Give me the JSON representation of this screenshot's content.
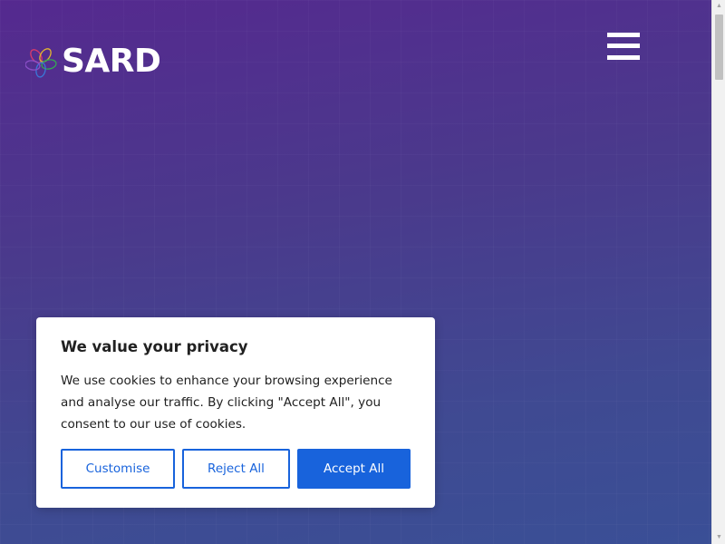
{
  "header": {
    "logo_text": "SARD",
    "logo_icon": "flower-logo-icon",
    "menu_icon": "hamburger-menu-icon"
  },
  "colors": {
    "hero_gradient_top": "#55298f",
    "hero_gradient_bottom": "#3a4f96",
    "accent_blue": "#1863dc",
    "logo_petals": [
      "#d93a6b",
      "#e2b530",
      "#35a853",
      "#3a76d6",
      "#8a4fc7"
    ]
  },
  "cookie_banner": {
    "title": "We value your privacy",
    "description": "We use cookies to enhance your browsing experience and analyse our traffic. By clicking \"Accept All\", you consent to our use of cookies.",
    "buttons": {
      "customise": "Customise",
      "reject": "Reject All",
      "accept": "Accept All"
    }
  },
  "scrollbar": {
    "up_icon": "scroll-up-arrow-icon",
    "down_icon": "scroll-down-arrow-icon"
  }
}
